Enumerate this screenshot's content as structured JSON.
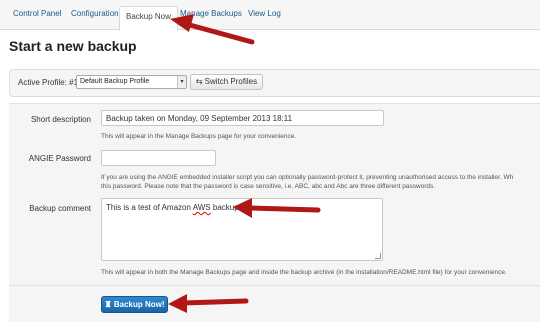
{
  "tabs": [
    {
      "label": "Control Panel"
    },
    {
      "label": "Configuration"
    },
    {
      "label": "Backup Now"
    },
    {
      "label": "Manage Backups"
    },
    {
      "label": "View Log"
    }
  ],
  "page_title": "Start a new backup",
  "profile": {
    "label": "Active Profile: #1",
    "selected": "Default Backup Profile",
    "switch_label": "Switch Profiles"
  },
  "form": {
    "short_description": {
      "label": "Short description",
      "value": "Backup taken on Monday, 09 September 2013 18:11",
      "help": "This will appear in the Manage Backups page for your convenience."
    },
    "angie_password": {
      "label": "ANGIE Password",
      "value": "",
      "help_line1": "If you are using the ANGIE embedded installer script you can optionally password-protect it, preventing unauthorised access to the installer. Wh",
      "help_line2": "this password. Please note that the password is case sensitive, i.e. ABC, abc and Abc are three different passwords."
    },
    "backup_comment": {
      "label": "Backup comment",
      "value_part1": "This is a test of Amazon ",
      "value_misspelled": "AWS",
      "value_part2": " backup.",
      "help": "This will appear in both the Manage Backups page and inside the backup archive (in the installation/README.html file) for your convenience."
    }
  },
  "backup_button": {
    "label": "Backup Now!"
  },
  "colors": {
    "annotation_arrow": "#b01818",
    "primary_button": "#1f6fb8",
    "tab_link": "#1a5a8a"
  }
}
